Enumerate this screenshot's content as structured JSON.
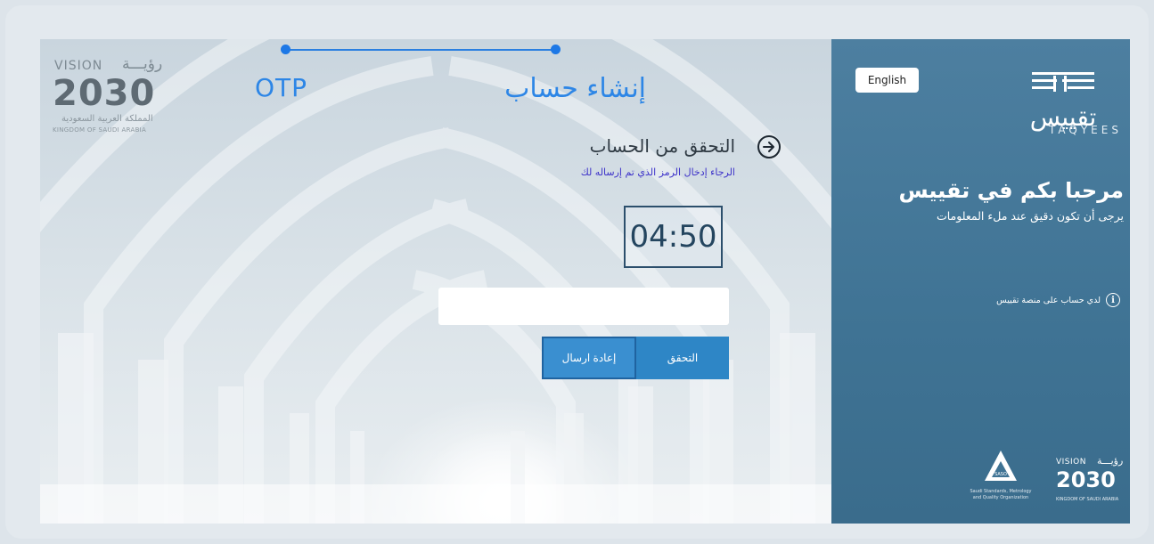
{
  "header": {
    "steps": [
      {
        "label": "OTP"
      },
      {
        "label": "إنشاء حساب"
      }
    ]
  },
  "vision_logo": {
    "word": "VISION",
    "arabic_word": "رؤيـــة",
    "year": "2030",
    "subtitle_ar": "المملكة العربية السعودية",
    "subtitle_en": "KINGDOM OF SAUDI ARABIA"
  },
  "verification": {
    "title": "التحقق من الحساب",
    "subtitle": "الرجاء إدخال الرمز الذي تم إرساله لك",
    "timer": "04:50",
    "code_input": {
      "value": "",
      "placeholder": ""
    },
    "resend_label": "إعادة ارسال",
    "verify_label": "التحقق"
  },
  "sidebar": {
    "language_button": "English",
    "logo_ar": "تقييس",
    "logo_en": "TAQYEES",
    "welcome_title": "مرحبا بكم في تقييس",
    "welcome_subtitle": "يرجى أن تكون دقيق عند ملء المعلومات",
    "have_account": "لدي حساب على منصة تقييس",
    "saso_text": "Saudi Standards, Metrology and Quality Organization",
    "saso_mark": "SASO"
  },
  "colors": {
    "accent_blue": "#2d86e6",
    "button_blue": "#2e86c6",
    "sidebar_blue": "#4d7fa0",
    "subtitle_purple": "#3c31c9"
  }
}
